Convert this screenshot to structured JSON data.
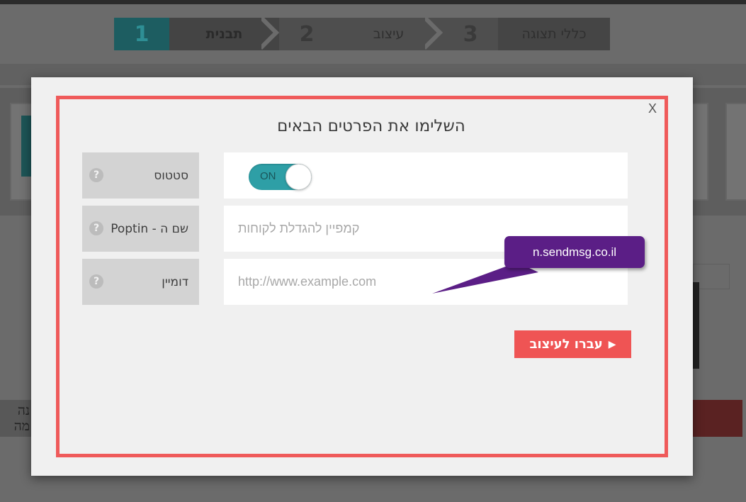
{
  "wizard": {
    "steps": [
      {
        "number": "1",
        "label": "תבנית"
      },
      {
        "number": "2",
        "label": "עיצוב"
      },
      {
        "number": "3",
        "label": "כללי תצוגה"
      }
    ]
  },
  "background": {
    "left_text": "נה\nמה"
  },
  "modal": {
    "close_label": "X",
    "title": "השלימו את הפרטים הבאים",
    "fields": {
      "status": {
        "label": "סטטוס",
        "help": "?",
        "toggle_text": "ON",
        "toggle_on": true
      },
      "name": {
        "label": "שם ה - Poptin",
        "help": "?",
        "value": "",
        "placeholder": "קמפיין להגדלת לקוחות"
      },
      "domain": {
        "label": "דומיין",
        "help": "?",
        "value": "",
        "placeholder": "http://www.example.com"
      }
    },
    "submit_label": "עברו לעיצוב",
    "submit_icon": "play-arrow-icon"
  },
  "callout": {
    "text": "n.sendmsg.co.il"
  },
  "colors": {
    "accent_red": "#ef5454",
    "toggle_teal": "#2e9fa6",
    "callout_purple": "#5b1e86"
  }
}
